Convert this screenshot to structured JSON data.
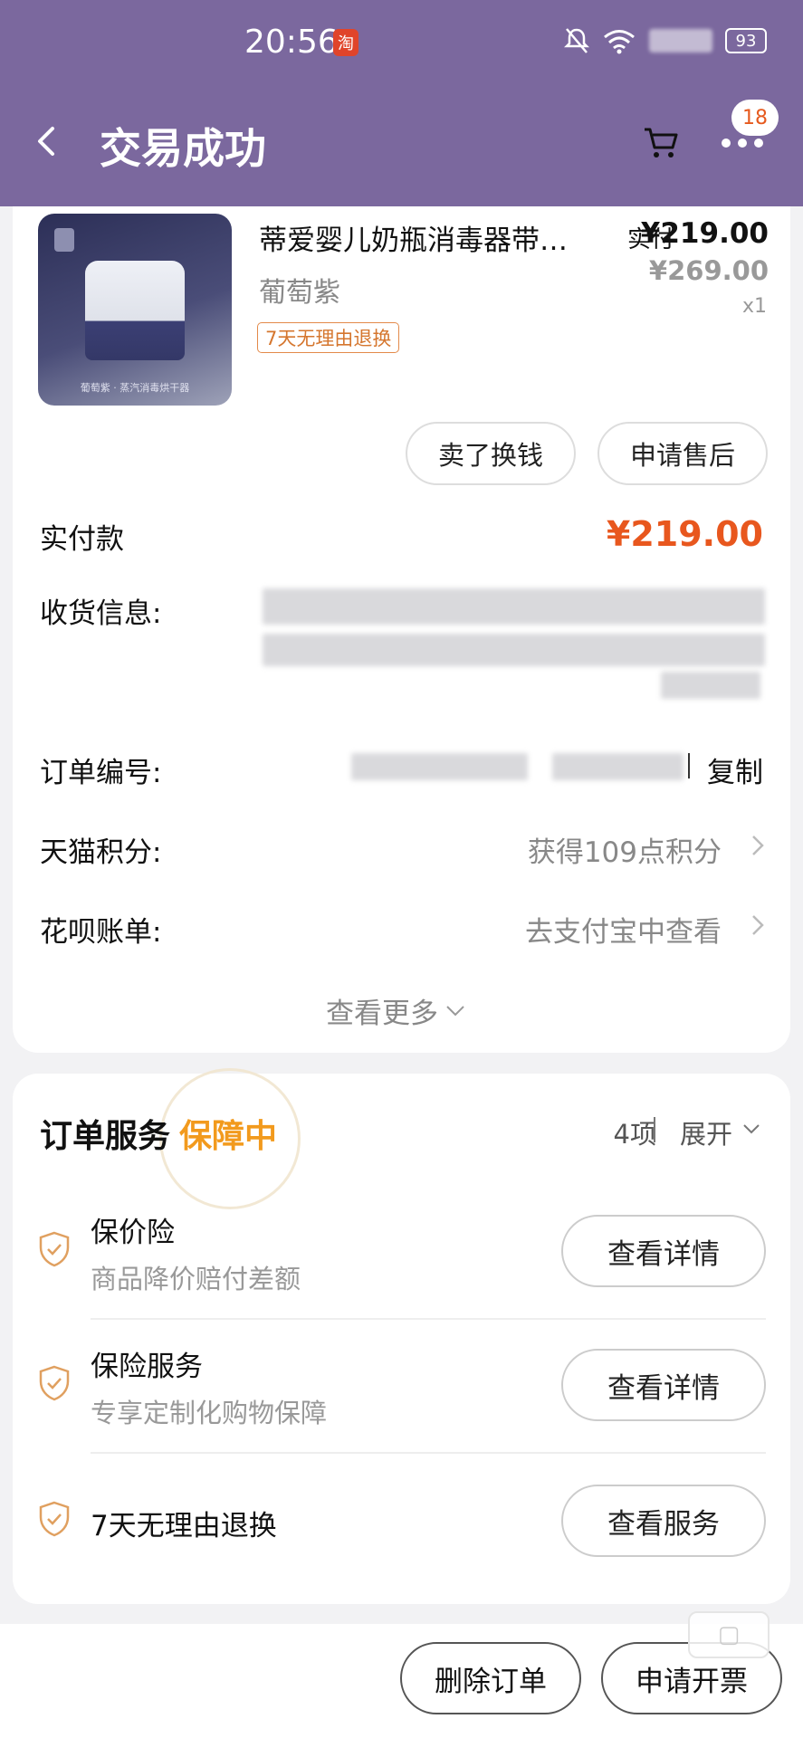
{
  "status_bar": {
    "time": "20:56",
    "app_icon_text": "淘",
    "battery": "93"
  },
  "header": {
    "title": "交易成功",
    "badge": "18",
    "back_icon": "back-arrow-icon",
    "cart_icon": "cart-icon",
    "more_icon": "more-dots-icon"
  },
  "product": {
    "name": "蒂爱婴儿奶瓶消毒器带…",
    "variant": "葡萄紫",
    "tag": "7天无理由退换",
    "paid_label": "实付",
    "paid_price": "¥219.00",
    "original_price": "¥269.00",
    "quantity": "x1",
    "image_caption": "葡萄紫 · 蒸汽消毒烘干器",
    "actions": [
      "卖了换钱",
      "申请售后"
    ]
  },
  "order": {
    "total_label": "实付款",
    "total_value": "¥219.00",
    "address_label": "收货信息:",
    "order_no_label": "订单编号:",
    "copy": "复制",
    "points_label": "天猫积分:",
    "points_value": "获得109点积分",
    "huabei_label": "花呗账单:",
    "huabei_value": "去支付宝中查看",
    "see_more": "查看更多"
  },
  "services": {
    "title": "订单服务",
    "status": "保障中",
    "count": "4项",
    "expand": "展开",
    "items": [
      {
        "name": "保价险",
        "desc": "商品降价赔付差额",
        "button": "查看详情"
      },
      {
        "name": "保险服务",
        "desc": "专享定制化购物保障",
        "button": "查看详情"
      },
      {
        "name": "7天无理由退换",
        "desc": "",
        "button": "查看服务"
      }
    ]
  },
  "bottom": {
    "delete": "删除订单",
    "invoice": "申请开票"
  },
  "colors": {
    "header_bg": "#7b689e",
    "price_orange": "#e8571e",
    "guarantee_orange": "#f29a1d",
    "tag_orange": "#d5762e"
  }
}
